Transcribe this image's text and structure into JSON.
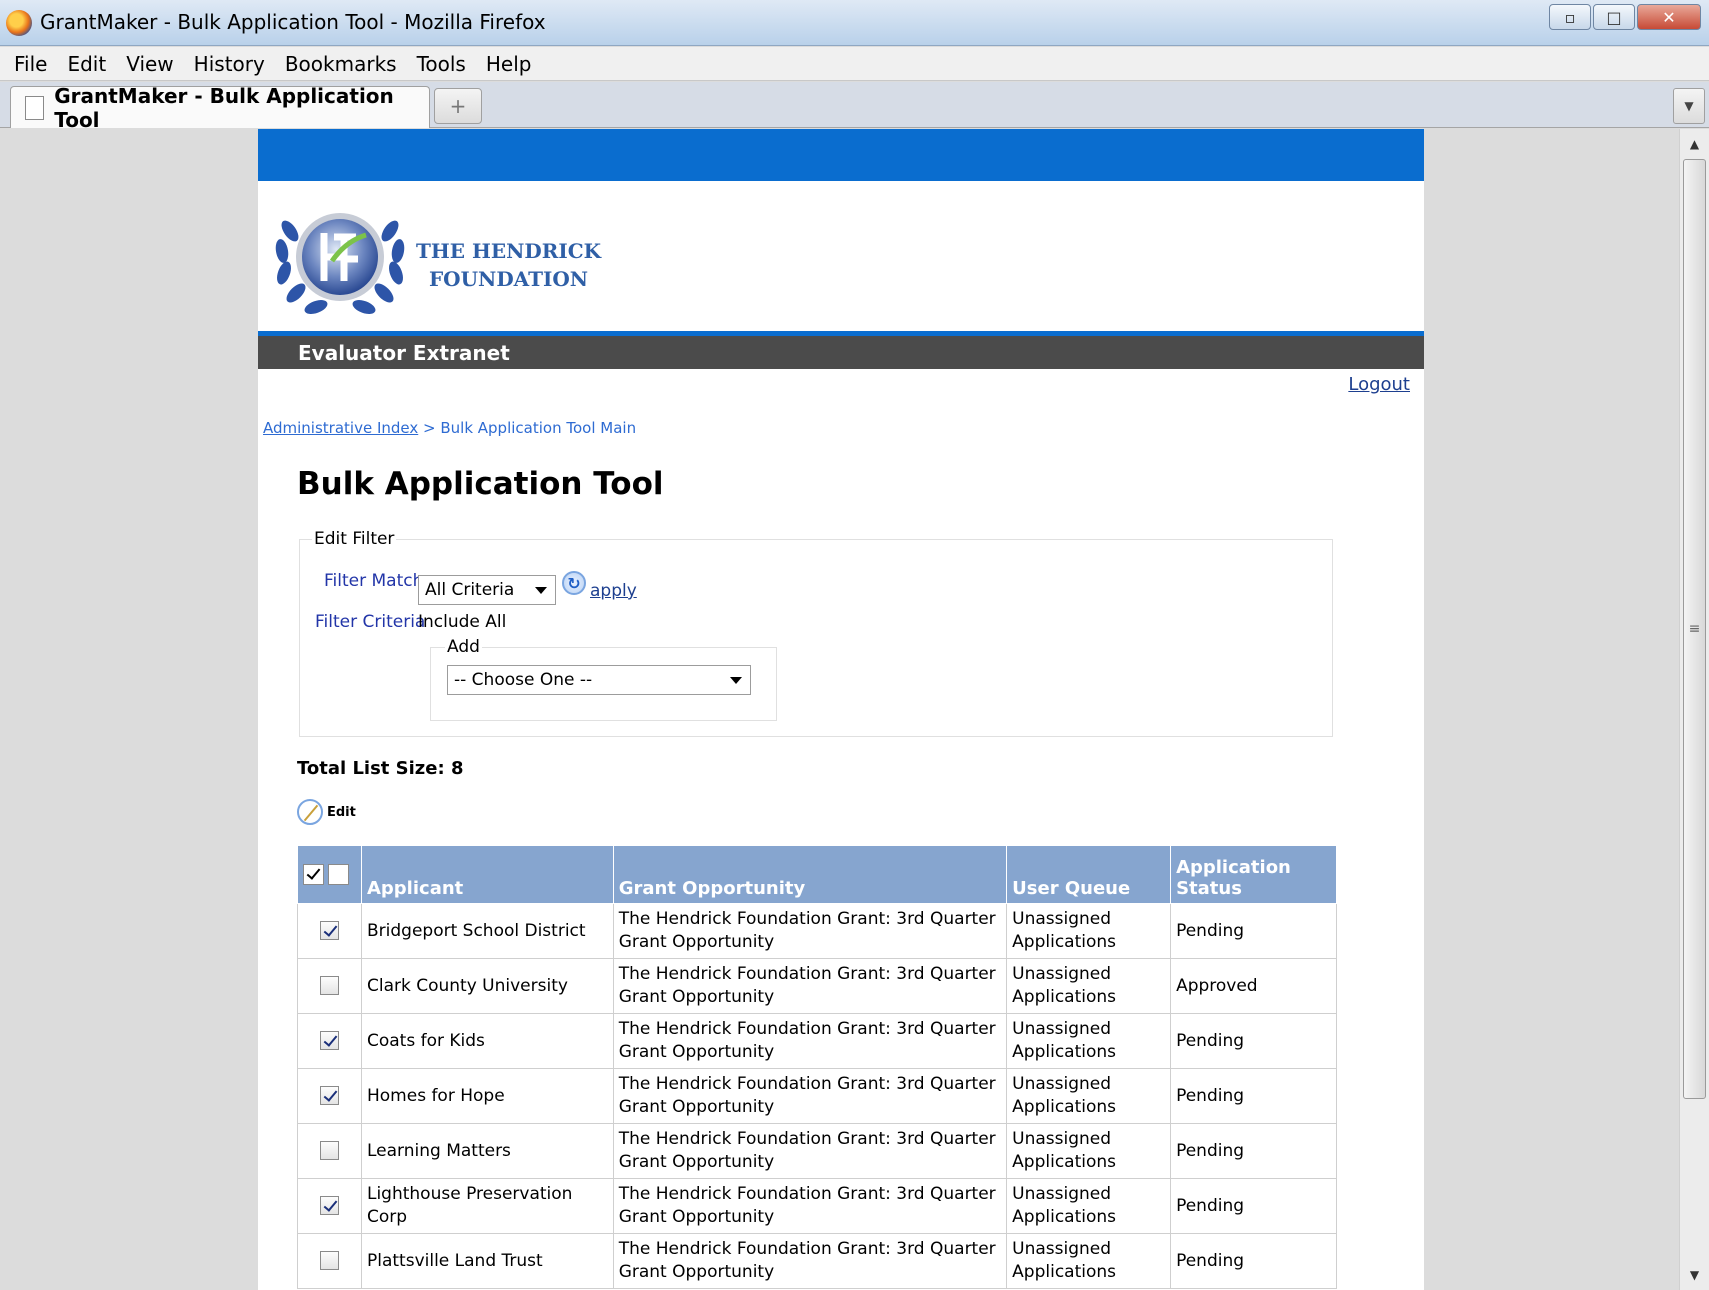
{
  "window": {
    "title": "GrantMaker - Bulk Application Tool - Mozilla Firefox"
  },
  "menu": [
    "File",
    "Edit",
    "View",
    "History",
    "Bookmarks",
    "Tools",
    "Help"
  ],
  "tab": {
    "label": "GrantMaker - Bulk Application Tool",
    "new_tab_symbol": "+"
  },
  "site": {
    "org_line1": "THE HENDRICK",
    "org_line2": "FOUNDATION",
    "nav_title": "Evaluator Extranet",
    "logout": "Logout",
    "brand_blue": "#0a6dcf"
  },
  "breadcrumb": {
    "link": "Administrative Index",
    "separator": " > ",
    "current": "Bulk Application Tool Main"
  },
  "page_title": "Bulk Application Tool",
  "filter": {
    "legend": "Edit Filter",
    "match_label": "Filter Match",
    "match_value": "All Criteria",
    "apply": "apply",
    "criteria_label": "Filter Criteria",
    "criteria_value": "Include All",
    "add_legend": "Add",
    "add_value": "-- Choose One --"
  },
  "total_list_size": "Total List Size: 8",
  "edit_label": "Edit",
  "table": {
    "headers": [
      "Applicant",
      "Grant Opportunity",
      "User Queue",
      "Application Status"
    ],
    "rows": [
      {
        "checked": true,
        "applicant": "Bridgeport School District",
        "opportunity": "The Hendrick Foundation Grant: 3rd Quarter Grant Opportunity",
        "queue": "Unassigned Applications",
        "status": "Pending"
      },
      {
        "checked": false,
        "applicant": "Clark County University",
        "opportunity": "The Hendrick Foundation Grant: 3rd Quarter Grant Opportunity",
        "queue": "Unassigned Applications",
        "status": "Approved"
      },
      {
        "checked": true,
        "applicant": "Coats for Kids",
        "opportunity": "The Hendrick Foundation Grant: 3rd Quarter Grant Opportunity",
        "queue": "Unassigned Applications",
        "status": "Pending"
      },
      {
        "checked": true,
        "applicant": "Homes for Hope",
        "opportunity": "The Hendrick Foundation Grant: 3rd Quarter Grant Opportunity",
        "queue": "Unassigned Applications",
        "status": "Pending"
      },
      {
        "checked": false,
        "applicant": "Learning Matters",
        "opportunity": "The Hendrick Foundation Grant: 3rd Quarter Grant Opportunity",
        "queue": "Unassigned Applications",
        "status": "Pending"
      },
      {
        "checked": true,
        "applicant": "Lighthouse Preservation Corp",
        "opportunity": "The Hendrick Foundation Grant: 3rd Quarter Grant Opportunity",
        "queue": "Unassigned Applications",
        "status": "Pending"
      },
      {
        "checked": false,
        "applicant": "Plattsville Land Trust",
        "opportunity": "The Hendrick Foundation Grant: 3rd Quarter Grant Opportunity",
        "queue": "Unassigned Applications",
        "status": "Pending"
      }
    ]
  }
}
